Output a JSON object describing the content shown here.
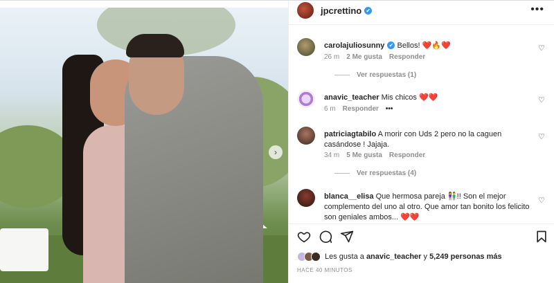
{
  "post": {
    "username": "jpcrettino",
    "verified_mark": "✔",
    "more_icon": "•••"
  },
  "comments": [
    {
      "username": "carolajuliosunny",
      "verified": true,
      "text": "Bellos!",
      "emoji": "❤️🔥❤️",
      "time": "26 m",
      "likes": "2 Me gusta",
      "reply_label": "Responder",
      "view_replies": "Ver respuestas (1)"
    },
    {
      "username": "anavic_teacher",
      "text": "Mis chicos",
      "emoji": "❤️❤️",
      "time": "6 m",
      "reply_label": "Responder",
      "more": "•••"
    },
    {
      "username": "patriciagtabilo",
      "text": "A morir con Uds 2 pero no la caguen casándose ! Jajaja.",
      "time": "34 m",
      "likes": "5 Me gusta",
      "reply_label": "Responder",
      "view_replies": "Ver respuestas (4)"
    },
    {
      "username": "blanca__elisa",
      "text": "Que hermosa pareja 👫!! Son el mejor complemento del uno al otro. Que amor tan bonito los felicito son geniales ambos...",
      "emoji": "❤️❤️"
    }
  ],
  "likes": {
    "prefix": "Les gusta a",
    "first_user": "anavic_teacher",
    "joiner": "y",
    "others": "5,249 personas más"
  },
  "timestamp": "HACE 40 MINUTOS",
  "icons": {
    "like": "heart-icon",
    "comment": "comment-icon",
    "share": "share-icon",
    "save": "bookmark-icon",
    "next": "chevron-right-icon"
  },
  "colors": {
    "verified": "#3897f0",
    "heart": "#ed4956",
    "muted": "#8e8e8e"
  }
}
